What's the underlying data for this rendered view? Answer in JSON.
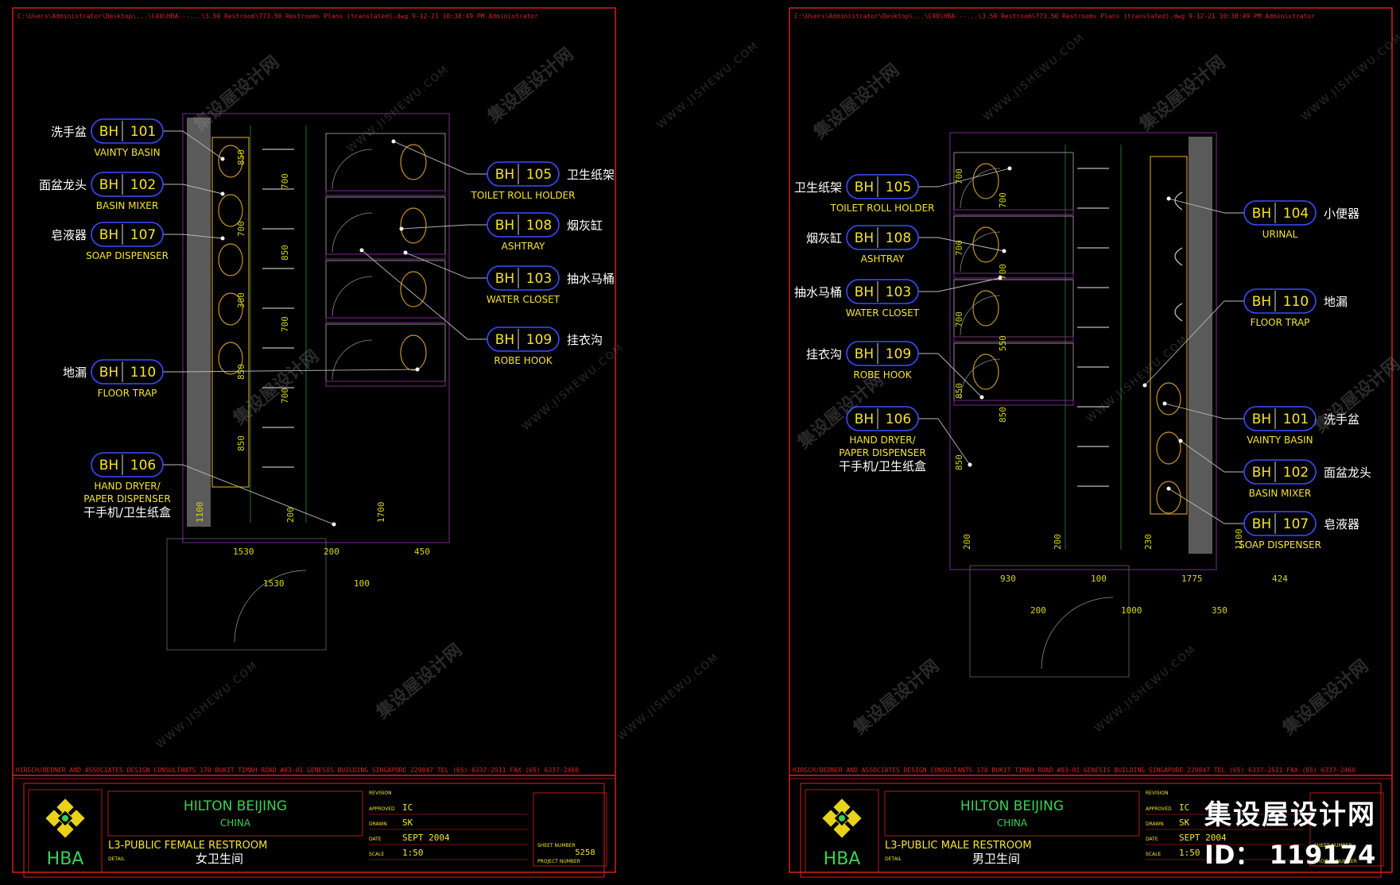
{
  "colors": {
    "border": "#e02020",
    "bubble": "#3a4cff",
    "text_yellow": "#f5e42a",
    "text_white": "#ffffff",
    "wall_grey": "#5a5a5a",
    "fixture": "#c8932a",
    "dim": "#d8d800",
    "title_green": "#3ccf55"
  },
  "sheets": [
    {
      "path": "C:\\Users\\Administrator\\Desktop\\...\\C40\\HBA---...\\3.50 Restroom\\773.50 Restrooms Plans (translated).dwg   9-12-21   10:38:49 PM   Administrator",
      "firm": "HIRSCH/BEDNER AND ASSOCIATES  DESIGN CONSULTANTS  170 BUKIT TIMAH ROAD #03-01 GENESIS BUILDING  SINGAPORE 229847  TEL (65) 6337-2511  FAX (65) 6337-2460",
      "logo_text": "HBA",
      "project": "HILTON BEIJING",
      "country": "CHINA",
      "drawing_title": "L3-PUBLIC FEMALE RESTROOM",
      "drawing_title_cn": "女卫生间",
      "detail_label": "DETAIL",
      "revision_label": "REVISION",
      "approved_label": "APPROVED",
      "approved": "IC",
      "drawn_label": "DRAWN",
      "drawn": "SK",
      "date_label": "DATE",
      "date": "SEPT 2004",
      "scale_label": "SCALE",
      "scale": "1:50",
      "sheet_number_label": "SHEET NUMBER",
      "project_number_label": "PROJECT NUMBER",
      "sheet_number": "5258",
      "dims": [
        "850",
        "700",
        "700",
        "850",
        "300",
        "700",
        "850",
        "700",
        "850",
        "1100",
        "1530",
        "1530",
        "200",
        "200",
        "100",
        "1700",
        "450"
      ],
      "tags": [
        {
          "code": "BH",
          "num": "101",
          "en": "VAINTY BASIN",
          "cn": "洗手盆"
        },
        {
          "code": "BH",
          "num": "102",
          "en": "BASIN MIXER",
          "cn": "面盆龙头"
        },
        {
          "code": "BH",
          "num": "107",
          "en": "SOAP DISPENSER",
          "cn": "皂液器"
        },
        {
          "code": "BH",
          "num": "110",
          "en": "FLOOR TRAP",
          "cn": "地漏"
        },
        {
          "code": "BH",
          "num": "106",
          "en": "HAND DRYER/",
          "en2": "PAPER DISPENSER",
          "cn": "干手机/卫生纸盒"
        },
        {
          "code": "BH",
          "num": "105",
          "en": "TOILET ROLL HOLDER",
          "cn": "卫生纸架"
        },
        {
          "code": "BH",
          "num": "108",
          "en": "ASHTRAY",
          "cn": "烟灰缸"
        },
        {
          "code": "BH",
          "num": "103",
          "en": "WATER CLOSET",
          "cn": "抽水马桶"
        },
        {
          "code": "BH",
          "num": "109",
          "en": "ROBE HOOK",
          "cn": "挂衣沟"
        }
      ]
    },
    {
      "path": "C:\\Users\\Administrator\\Desktop\\...\\C40\\HBA---...\\3.50 Restroom\\773.50 Restrooms Plans (translated).dwg   9-12-21   10:38:49 PM   Administrator",
      "firm": "HIRSCH/BEDNER AND ASSOCIATES  DESIGN CONSULTANTS  170 BUKIT TIMAH ROAD #03-01 GENESIS BUILDING  SINGAPORE 229847  TEL (65) 6337-2511  FAX (65) 6337-2460",
      "logo_text": "HBA",
      "project": "HILTON BEIJING",
      "country": "CHINA",
      "drawing_title": "L3-PUBLIC MALE RESTROOM",
      "drawing_title_cn": "男卫生间",
      "detail_label": "DETAIL",
      "revision_label": "REVISION",
      "approved_label": "APPROVED",
      "approved": "IC",
      "drawn_label": "DRAWN",
      "drawn": "SK",
      "date_label": "DATE",
      "date": "SEPT 2004",
      "scale_label": "SCALE",
      "scale": "1:50",
      "sheet_number_label": "SHEET NUMBER",
      "project_number_label": "PROJECT NUMBER",
      "sheet_number": "",
      "dims": [
        "700",
        "700",
        "700",
        "700",
        "700",
        "550",
        "850",
        "850",
        "850",
        "200",
        "930",
        "200",
        "200",
        "100",
        "1000",
        "230",
        "1775",
        "350",
        "1100",
        "424"
      ],
      "tags": [
        {
          "code": "BH",
          "num": "105",
          "en": "TOILET ROLL HOLDER",
          "cn": "卫生纸架"
        },
        {
          "code": "BH",
          "num": "108",
          "en": "ASHTRAY",
          "cn": "烟灰缸"
        },
        {
          "code": "BH",
          "num": "103",
          "en": "WATER CLOSET",
          "cn": "抽水马桶"
        },
        {
          "code": "BH",
          "num": "109",
          "en": "ROBE HOOK",
          "cn": "挂衣沟"
        },
        {
          "code": "BH",
          "num": "106",
          "en": "HAND DRYER/",
          "en2": "PAPER DISPENSER",
          "cn": "干手机/卫生纸盒"
        },
        {
          "code": "BH",
          "num": "104",
          "en": "URINAL",
          "cn": "小便器"
        },
        {
          "code": "BH",
          "num": "110",
          "en": "FLOOR TRAP",
          "cn": "地漏"
        },
        {
          "code": "BH",
          "num": "101",
          "en": "VAINTY BASIN",
          "cn": "洗手盆"
        },
        {
          "code": "BH",
          "num": "102",
          "en": "BASIN MIXER",
          "cn": "面盆龙头"
        },
        {
          "code": "BH",
          "num": "107",
          "en": "SOAP DISPENSER",
          "cn": "皂液器"
        }
      ]
    }
  ],
  "watermark": {
    "cn": "集设屋设计网",
    "en": "WWW.JISHEWU.COM"
  },
  "brand": {
    "name": "集设屋设计网",
    "id": "ID： 119174"
  }
}
